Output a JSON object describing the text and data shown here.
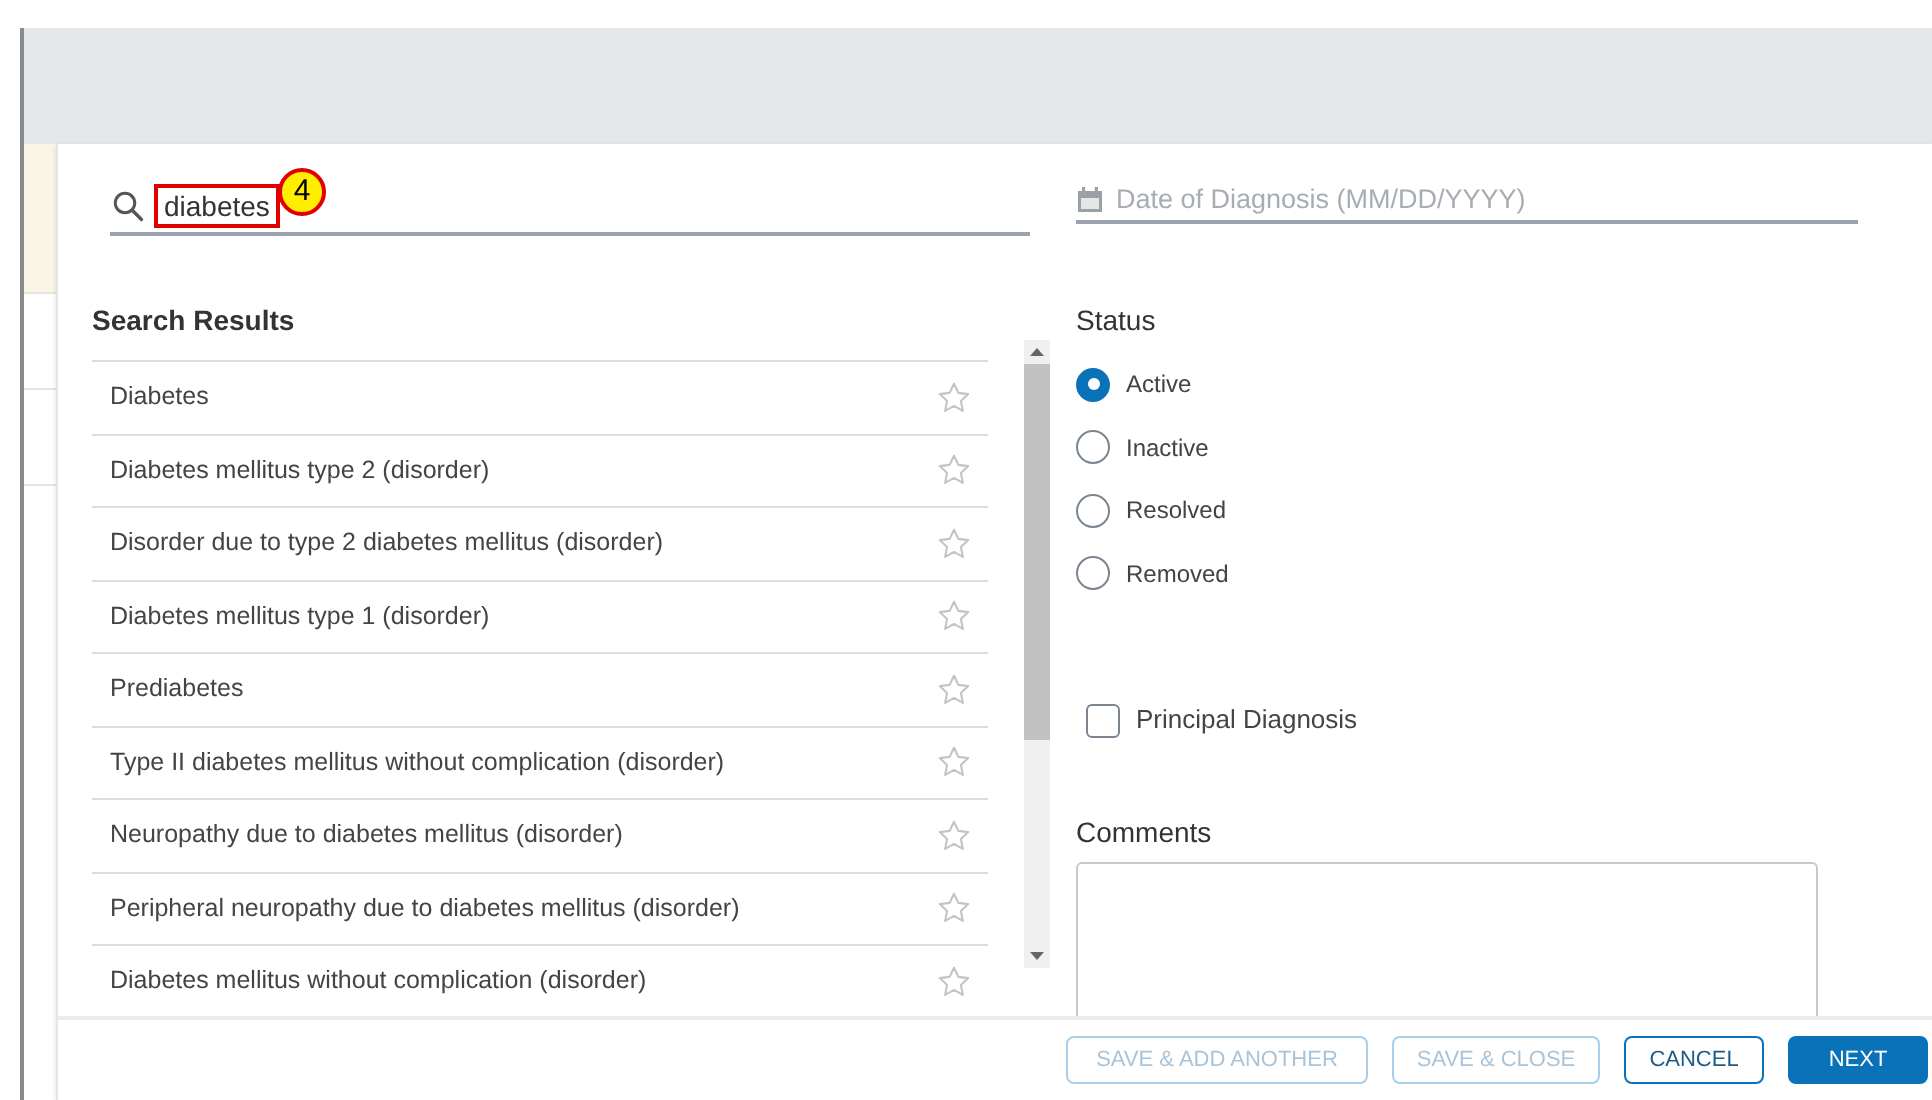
{
  "search": {
    "value": "diabetes",
    "callout": "4"
  },
  "date_field": {
    "placeholder": "Date of Diagnosis (MM/DD/YYYY)"
  },
  "results": {
    "title": "Search Results",
    "items": [
      {
        "label": "Diabetes",
        "starred": false
      },
      {
        "label": "Diabetes mellitus type 2 (disorder)",
        "starred": false
      },
      {
        "label": "Disorder due to type 2 diabetes mellitus (disorder)",
        "starred": false
      },
      {
        "label": "Diabetes mellitus type 1 (disorder)",
        "starred": false
      },
      {
        "label": "Prediabetes",
        "starred": false
      },
      {
        "label": "Type II diabetes mellitus without complication (disorder)",
        "starred": false
      },
      {
        "label": "Neuropathy due to diabetes mellitus (disorder)",
        "starred": false
      },
      {
        "label": "Peripheral neuropathy due to diabetes mellitus (disorder)",
        "starred": false
      },
      {
        "label": "Diabetes mellitus without complication (disorder)",
        "starred": false
      }
    ]
  },
  "status": {
    "title": "Status",
    "options": [
      {
        "label": "Active",
        "selected": true
      },
      {
        "label": "Inactive",
        "selected": false
      },
      {
        "label": "Resolved",
        "selected": false
      },
      {
        "label": "Removed",
        "selected": false
      }
    ]
  },
  "principal_diagnosis": {
    "label": "Principal Diagnosis",
    "checked": false
  },
  "comments": {
    "label": "Comments"
  },
  "buttons": [
    {
      "label": "SAVE & ADD ANOTHER",
      "kind": "outline",
      "disabled": true
    },
    {
      "label": "SAVE & CLOSE",
      "kind": "outline",
      "disabled": true
    },
    {
      "label": "CANCEL",
      "kind": "outline",
      "disabled": false
    },
    {
      "label": "NEXT",
      "kind": "primary",
      "disabled": false
    }
  ]
}
